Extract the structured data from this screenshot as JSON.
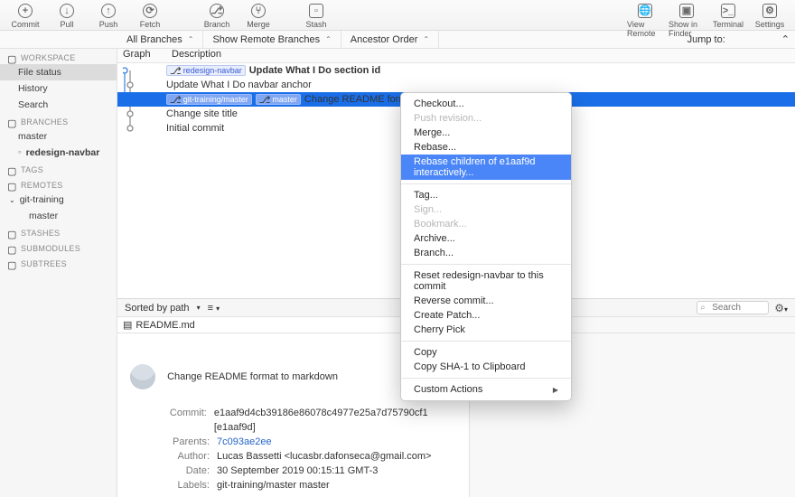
{
  "toolbar": {
    "left": [
      {
        "label": "Commit",
        "icon": "+"
      },
      {
        "label": "Pull",
        "icon": "↓"
      },
      {
        "label": "Push",
        "icon": "↑"
      },
      {
        "label": "Fetch",
        "icon": "⟳"
      }
    ],
    "mid": [
      {
        "label": "Branch",
        "icon": "⎇"
      },
      {
        "label": "Merge",
        "icon": "⑂"
      }
    ],
    "stash": {
      "label": "Stash",
      "icon": "▫"
    },
    "right": [
      {
        "label": "View Remote",
        "icon": "🌐"
      },
      {
        "label": "Show in Finder",
        "icon": "▣"
      },
      {
        "label": "Terminal",
        "icon": ">_"
      },
      {
        "label": "Settings",
        "icon": "⚙"
      }
    ]
  },
  "filter": {
    "branches": "All Branches",
    "remote": "Show Remote Branches",
    "order": "Ancestor Order",
    "jump": "Jump to:"
  },
  "sidebar": {
    "sections": [
      {
        "title": "WORKSPACE",
        "items": [
          {
            "label": "File status",
            "active": true
          },
          {
            "label": "History"
          },
          {
            "label": "Search"
          }
        ]
      },
      {
        "title": "BRANCHES",
        "items": [
          {
            "label": "master"
          },
          {
            "label": "redesign-navbar",
            "bold": true,
            "bullet": true
          }
        ]
      },
      {
        "title": "TAGS",
        "items": []
      },
      {
        "title": "REMOTES",
        "items": [
          {
            "label": "git-training",
            "caret": true
          },
          {
            "label": "master",
            "sub": true
          }
        ]
      },
      {
        "title": "STASHES",
        "items": []
      },
      {
        "title": "SUBMODULES",
        "items": []
      },
      {
        "title": "SUBTREES",
        "items": []
      }
    ]
  },
  "list": {
    "headers": {
      "graph": "Graph",
      "desc": "Description"
    },
    "rows": [
      {
        "tags": [
          {
            "t": "redesign-navbar",
            "icon": "⎇"
          }
        ],
        "desc": "Update What I Do section id",
        "bold": true
      },
      {
        "desc": "Update What I Do navbar anchor"
      },
      {
        "tags": [
          {
            "t": "git-training/master",
            "icon": "⎇"
          },
          {
            "t": "master",
            "icon": "⎇"
          }
        ],
        "desc": "Change README format to markdown",
        "selected": true
      },
      {
        "desc": "Change site title"
      },
      {
        "desc": "Initial commit"
      }
    ]
  },
  "context": {
    "items": [
      {
        "t": "Checkout..."
      },
      {
        "t": "Push revision...",
        "dis": true
      },
      {
        "t": "Merge..."
      },
      {
        "t": "Rebase..."
      },
      {
        "t": "Rebase children of e1aaf9d interactively...",
        "hl": true
      },
      {
        "sep": true
      },
      {
        "t": "Tag..."
      },
      {
        "t": "Sign...",
        "dis": true
      },
      {
        "t": "Bookmark...",
        "dis": true
      },
      {
        "t": "Archive..."
      },
      {
        "t": "Branch..."
      },
      {
        "sep": true
      },
      {
        "t": "Reset redesign-navbar to this commit"
      },
      {
        "t": "Reverse commit..."
      },
      {
        "t": "Create Patch..."
      },
      {
        "t": "Cherry Pick"
      },
      {
        "sep": true
      },
      {
        "t": "Copy"
      },
      {
        "t": "Copy SHA-1 to Clipboard"
      },
      {
        "sep": true
      },
      {
        "t": "Custom Actions",
        "sub": true
      }
    ]
  },
  "sortbar": {
    "label": "Sorted by path",
    "search_ph": "Search"
  },
  "file": {
    "name": "README.md"
  },
  "commit": {
    "subject": "Change README format to markdown",
    "hash": "e1aaf9d4cb39186e86078c4977e25a7d75790cf1 [e1aaf9d]",
    "parents": "7c093ae2ee",
    "author": "Lucas Bassetti <lucasbr.dafonseca@gmail.com>",
    "date": "30 September 2019 00:15:11 GMT-3",
    "labels": "git-training/master master",
    "keys": {
      "commit": "Commit:",
      "parents": "Parents:",
      "author": "Author:",
      "date": "Date:",
      "labels": "Labels:"
    }
  }
}
